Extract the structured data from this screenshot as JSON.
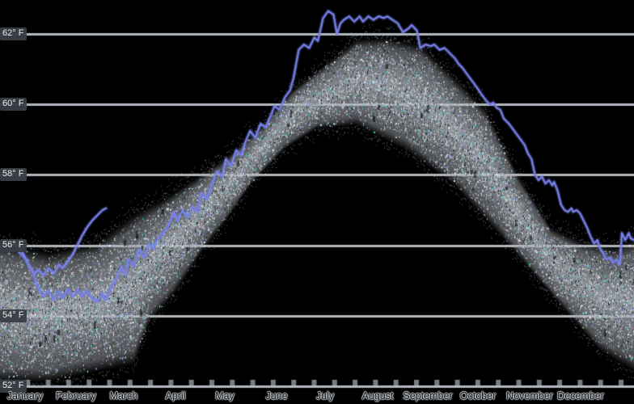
{
  "chart": {
    "y_axis": {
      "unit": "°F",
      "labels": [
        "62° F",
        "60° F",
        "58° F",
        "56° F",
        "54° F",
        "52° F"
      ]
    },
    "x_axis": {
      "months": [
        "January",
        "February",
        "March",
        "April",
        "May",
        "June",
        "July",
        "August",
        "September",
        "October",
        "November",
        "December"
      ]
    },
    "colors": {
      "background": "#000000",
      "gridline": "#b3b8be",
      "band_dot": "#b0b5bc",
      "speckle_light": "#c9ced3",
      "speckle_mid": "#7f868e",
      "speckle_white": "#eef1f4",
      "speckle_dark": "#101316",
      "speckle_cyan": "#3ed2c4",
      "speckle_blue": "#7f88ea",
      "line": "#6a74e2",
      "line_glow": "#8b93ee",
      "badge_bg": "#383e45",
      "badge_text": "#e9ecef",
      "month_text": "#121519"
    }
  },
  "chart_data": {
    "type": "line",
    "title": "",
    "xlabel": "months January–December",
    "ylabel": "temperature (°F)",
    "xlim_days": [
      0,
      365
    ],
    "ylim": [
      51.5,
      63.0
    ],
    "grid": "horizontal",
    "gridlines_tempF": [
      62,
      60,
      58,
      56,
      54,
      52
    ],
    "series": [
      {
        "name": "daily-temperature-full-year",
        "color": "#6a74e2",
        "points": [
          [
            11,
            55.8
          ],
          [
            15,
            55.6
          ],
          [
            19,
            55.2
          ],
          [
            22,
            54.8
          ],
          [
            25,
            54.55
          ],
          [
            28,
            54.7
          ],
          [
            31,
            54.45
          ],
          [
            34,
            54.7
          ],
          [
            36,
            54.5
          ],
          [
            39,
            54.75
          ],
          [
            42,
            54.55
          ],
          [
            45,
            54.75
          ],
          [
            47,
            54.55
          ],
          [
            50,
            54.7
          ],
          [
            53,
            54.5
          ],
          [
            56,
            54.4
          ],
          [
            59,
            54.65
          ],
          [
            61,
            54.45
          ],
          [
            64,
            54.8
          ],
          [
            67,
            55.05
          ],
          [
            70,
            55.4
          ],
          [
            72,
            55.15
          ],
          [
            74,
            55.6
          ],
          [
            77,
            55.4
          ],
          [
            80,
            55.9
          ],
          [
            83,
            55.65
          ],
          [
            86,
            56.05
          ],
          [
            88,
            55.9
          ],
          [
            91,
            56.2
          ],
          [
            94,
            56.35
          ],
          [
            97,
            56.55
          ],
          [
            100,
            56.95
          ],
          [
            102,
            56.7
          ],
          [
            105,
            57.0
          ],
          [
            108,
            56.8
          ],
          [
            111,
            57.1
          ],
          [
            114,
            56.95
          ],
          [
            116,
            57.5
          ],
          [
            119,
            57.3
          ],
          [
            122,
            57.75
          ],
          [
            125,
            58.1
          ],
          [
            128,
            57.95
          ],
          [
            130,
            58.45
          ],
          [
            133,
            58.25
          ],
          [
            136,
            58.7
          ],
          [
            139,
            58.55
          ],
          [
            141,
            58.9
          ],
          [
            144,
            59.25
          ],
          [
            147,
            59.05
          ],
          [
            150,
            59.45
          ],
          [
            153,
            59.35
          ],
          [
            156,
            59.7
          ],
          [
            158,
            59.95
          ],
          [
            161,
            59.85
          ],
          [
            164,
            60.2
          ],
          [
            167,
            60.4
          ],
          [
            169,
            60.75
          ],
          [
            172,
            61.55
          ],
          [
            175,
            61.7
          ],
          [
            178,
            61.6
          ],
          [
            181,
            61.9
          ],
          [
            183,
            61.8
          ],
          [
            186,
            62.45
          ],
          [
            189,
            62.65
          ],
          [
            192,
            62.55
          ],
          [
            194,
            62.0
          ],
          [
            196,
            62.3
          ],
          [
            198,
            62.4
          ],
          [
            201,
            62.5
          ],
          [
            204,
            62.35
          ],
          [
            207,
            62.5
          ],
          [
            209,
            62.35
          ],
          [
            212,
            62.5
          ],
          [
            215,
            62.4
          ],
          [
            218,
            62.5
          ],
          [
            221,
            62.45
          ],
          [
            223,
            62.5
          ],
          [
            226,
            62.4
          ],
          [
            229,
            62.3
          ],
          [
            232,
            62.05
          ],
          [
            235,
            62.15
          ],
          [
            237,
            62.25
          ],
          [
            240,
            62.1
          ],
          [
            242,
            61.6
          ],
          [
            245,
            61.7
          ],
          [
            248,
            61.65
          ],
          [
            250,
            61.7
          ],
          [
            253,
            61.55
          ],
          [
            256,
            61.6
          ],
          [
            259,
            61.45
          ],
          [
            262,
            61.3
          ],
          [
            264,
            61.15
          ],
          [
            266,
            61.05
          ],
          [
            269,
            60.85
          ],
          [
            272,
            60.65
          ],
          [
            275,
            60.45
          ],
          [
            277,
            60.3
          ],
          [
            280,
            60.1
          ],
          [
            282,
            60.0
          ],
          [
            284,
            60.05
          ],
          [
            286,
            59.9
          ],
          [
            288,
            59.85
          ],
          [
            290,
            59.6
          ],
          [
            293,
            59.45
          ],
          [
            296,
            59.25
          ],
          [
            299,
            59.05
          ],
          [
            302,
            58.85
          ],
          [
            304,
            58.6
          ],
          [
            306,
            58.45
          ],
          [
            308,
            58.0
          ],
          [
            310,
            57.85
          ],
          [
            312,
            57.95
          ],
          [
            314,
            57.75
          ],
          [
            316,
            57.85
          ],
          [
            318,
            57.7
          ],
          [
            319,
            57.8
          ],
          [
            321,
            57.55
          ],
          [
            323,
            57.15
          ],
          [
            325,
            57.0
          ],
          [
            327,
            56.95
          ],
          [
            329,
            57.05
          ],
          [
            330,
            56.95
          ],
          [
            332,
            57.0
          ],
          [
            334,
            56.9
          ],
          [
            336,
            56.7
          ],
          [
            338,
            56.5
          ],
          [
            340,
            56.25
          ],
          [
            342,
            56.05
          ],
          [
            344,
            56.15
          ],
          [
            345,
            55.95
          ],
          [
            347,
            55.8
          ],
          [
            349,
            55.6
          ],
          [
            351,
            55.65
          ],
          [
            353,
            55.5
          ],
          [
            355,
            55.6
          ],
          [
            357,
            55.45
          ],
          [
            358,
            56.35
          ],
          [
            360,
            56.15
          ],
          [
            362,
            56.35
          ],
          [
            363,
            56.2
          ],
          [
            365,
            56.15
          ]
        ]
      },
      {
        "name": "partial-year-temperature",
        "color": "#7279e6",
        "points": [
          [
            11,
            56.0
          ],
          [
            14,
            55.7
          ],
          [
            17,
            55.4
          ],
          [
            20,
            55.2
          ],
          [
            22,
            55.3
          ],
          [
            25,
            55.15
          ],
          [
            28,
            55.35
          ],
          [
            31,
            55.2
          ],
          [
            34,
            55.45
          ],
          [
            36,
            55.35
          ],
          [
            39,
            55.55
          ],
          [
            42,
            55.75
          ],
          [
            45,
            56.05
          ],
          [
            47,
            56.25
          ],
          [
            50,
            56.5
          ],
          [
            53,
            56.7
          ],
          [
            56,
            56.85
          ],
          [
            59,
            57.0
          ],
          [
            61,
            57.05
          ]
        ]
      }
    ],
    "band": {
      "name": "historical-temperature-scatter-band",
      "upper": [
        [
          0,
          56.1
        ],
        [
          28,
          55.8
        ],
        [
          56,
          56.1
        ],
        [
          77,
          56.9
        ],
        [
          93,
          57.3
        ],
        [
          112,
          57.9
        ],
        [
          130,
          58.5
        ],
        [
          149,
          59.3
        ],
        [
          168,
          60.4
        ],
        [
          186,
          61.1
        ],
        [
          205,
          61.85
        ],
        [
          223,
          61.9
        ],
        [
          242,
          61.7
        ],
        [
          261,
          60.8
        ],
        [
          279,
          59.9
        ],
        [
          298,
          58.0
        ],
        [
          317,
          56.5
        ],
        [
          335,
          56.1
        ],
        [
          354,
          55.95
        ],
        [
          365,
          56.2
        ]
      ],
      "lower": [
        [
          0,
          52.1
        ],
        [
          28,
          52.1
        ],
        [
          56,
          52.4
        ],
        [
          77,
          52.6
        ],
        [
          86,
          53.8
        ],
        [
          100,
          54.6
        ],
        [
          116,
          55.8
        ],
        [
          130,
          56.7
        ],
        [
          144,
          57.7
        ],
        [
          163,
          58.7
        ],
        [
          182,
          59.3
        ],
        [
          205,
          59.4
        ],
        [
          233,
          58.7
        ],
        [
          261,
          57.7
        ],
        [
          289,
          56.2
        ],
        [
          317,
          54.6
        ],
        [
          345,
          53.0
        ],
        [
          365,
          52.4
        ]
      ]
    }
  }
}
